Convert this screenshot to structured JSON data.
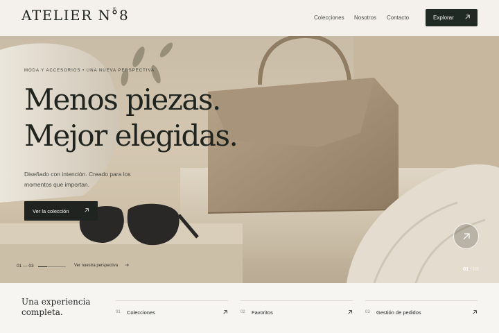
{
  "header": {
    "logo": "ATELIER N°8",
    "logo_mark": "®",
    "nav": [
      "Colecciones",
      "Nosotros",
      "Contacto"
    ],
    "explore_label": "Explorar"
  },
  "hero": {
    "kicker": "MODA Y ACCESORIOS  •  UNA NUEVA PERSPECTIVA",
    "headline_line1": "Menos piezas.",
    "headline_line2": "Mejor elegidas.",
    "subtitle": "Diseñado con intención. Creado para los momentos que importan.",
    "cta_label": "Ver la colección",
    "counter": "01 — 03",
    "progress": 0.33,
    "perspective_link": "Ver nuestra perspectiva",
    "slide_current": "01",
    "slide_separator": " / ",
    "slide_total": "03"
  },
  "bottom": {
    "title": "Una experiencia completa.",
    "features": [
      {
        "num": "01",
        "label": "Colecciones"
      },
      {
        "num": "02",
        "label": "Favoritos"
      },
      {
        "num": "03",
        "label": "Gestión de pedidos"
      }
    ]
  },
  "colors": {
    "background": "#f4f1ec",
    "dark_accent": "#1f2a24",
    "text": "#1f2420"
  },
  "icons": [
    "arrow-up-right-icon"
  ]
}
